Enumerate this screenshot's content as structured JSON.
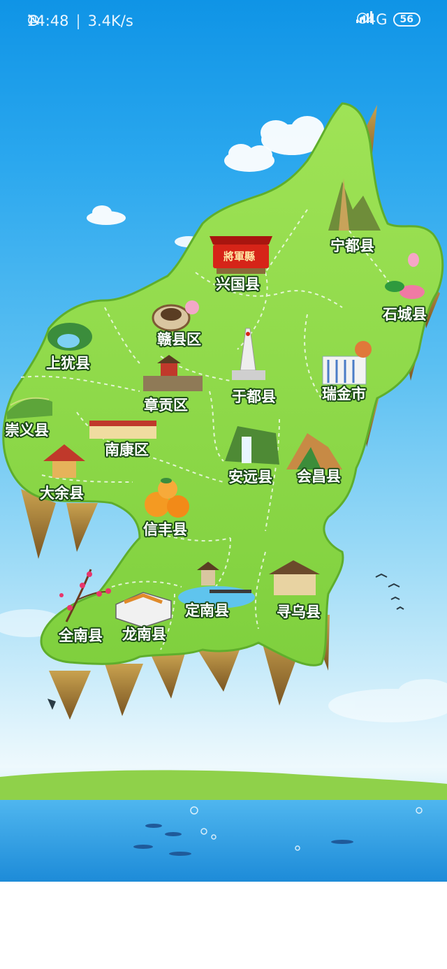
{
  "status_bar": {
    "time": "14:48",
    "network_speed": "3.4K/s",
    "network_type": "4G",
    "battery": "56",
    "icons": [
      "bell-muted-icon",
      "alarm-icon",
      "hotspot-icon",
      "signal-icon"
    ]
  },
  "map": {
    "landmark_banner_text": "將軍縣",
    "regions": [
      {
        "name": "宁都县",
        "landmark": "mountain-peak-icon"
      },
      {
        "name": "兴国县",
        "landmark": "red-banner-icon"
      },
      {
        "name": "石城县",
        "landmark": "lotus-icon"
      },
      {
        "name": "赣县区",
        "landmark": "round-earth-building-icon"
      },
      {
        "name": "上犹县",
        "landmark": "lake-mountain-icon"
      },
      {
        "name": "瑞金市",
        "landmark": "government-building-icon"
      },
      {
        "name": "于都县",
        "landmark": "monument-icon"
      },
      {
        "name": "章贡区",
        "landmark": "city-wall-icon"
      },
      {
        "name": "崇义县",
        "landmark": "terraced-fields-icon"
      },
      {
        "name": "南康区",
        "landmark": "furniture-market-icon"
      },
      {
        "name": "安远县",
        "landmark": "waterfall-icon"
      },
      {
        "name": "会昌县",
        "landmark": "red-rock-mountain-icon"
      },
      {
        "name": "大余县",
        "landmark": "pavilion-icon"
      },
      {
        "name": "信丰县",
        "landmark": "navel-orange-icon"
      },
      {
        "name": "定南县",
        "landmark": "lake-pavilion-icon"
      },
      {
        "name": "寻乌县",
        "landmark": "ancestral-hall-icon"
      },
      {
        "name": "全南县",
        "landmark": "plum-blossom-icon"
      },
      {
        "name": "龙南县",
        "landmark": "walled-house-icon"
      }
    ]
  },
  "colors": {
    "sky_top": "#0f94e6",
    "land_green": "#8fdc4a",
    "cliff_brown": "#b58a3c",
    "label_outline": "#1a4a15"
  }
}
